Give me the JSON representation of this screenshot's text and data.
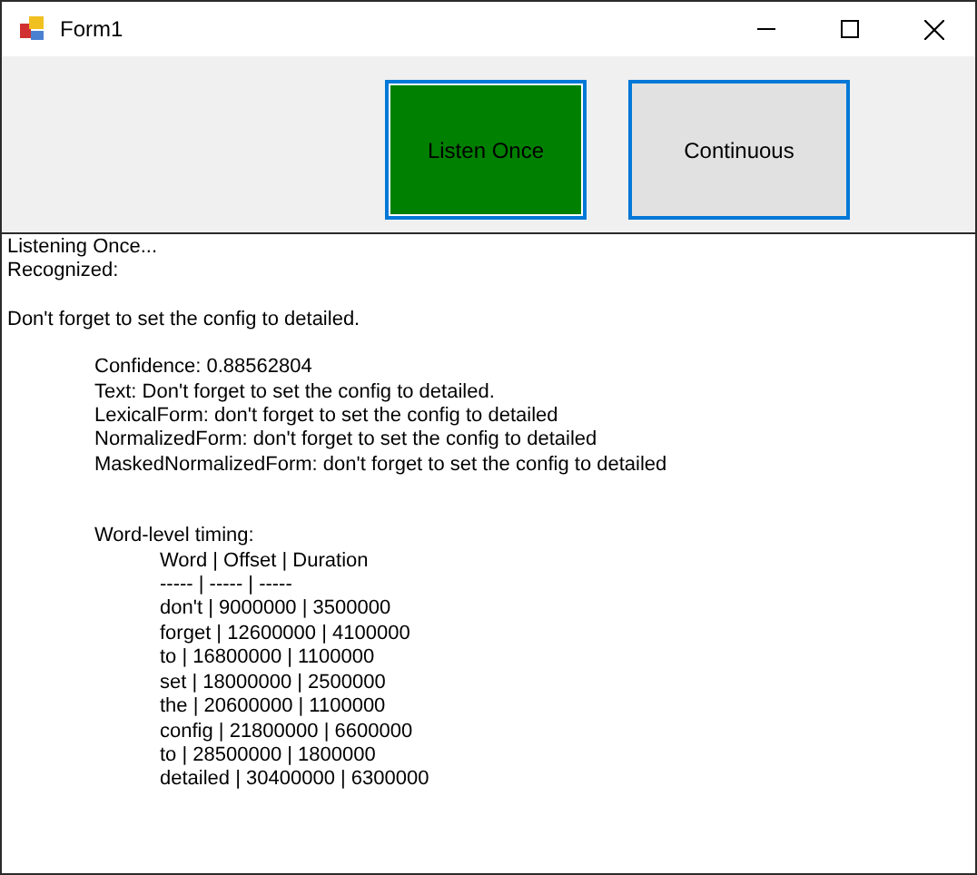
{
  "window": {
    "title": "Form1"
  },
  "buttons": [
    {
      "label": "Listen Once",
      "active": true
    },
    {
      "label": "Continuous",
      "active": false
    }
  ],
  "log": [
    {
      "text": "Listening Once..."
    },
    {
      "text": "Recognized:"
    },
    {
      "text": "Don't forget to set the config to detailed.",
      "children": [
        {
          "text": "Confidence: 0.88562804"
        },
        {
          "text": "Text: Don't forget to set the config to detailed."
        },
        {
          "text": "LexicalForm: don't forget to set the config to detailed"
        },
        {
          "text": "NormalizedForm: don't forget to set the config to detailed"
        },
        {
          "text": "MaskedNormalizedForm: don't forget to set the config to detailed"
        },
        {
          "text": "Word-level timing:",
          "children": [
            {
              "text": "Word | Offset | Duration"
            },
            {
              "text": "----- | ----- | -----"
            },
            {
              "text": "don't | 9000000 | 3500000"
            },
            {
              "text": "forget | 12600000 | 4100000"
            },
            {
              "text": "to | 16800000 | 1100000"
            },
            {
              "text": "set | 18000000 | 2500000"
            },
            {
              "text": "the | 20600000 | 1100000"
            },
            {
              "text": "config | 21800000 | 6600000"
            },
            {
              "text": "to | 28500000 | 1800000"
            },
            {
              "text": "detailed | 30400000 | 6300000"
            }
          ]
        }
      ]
    }
  ]
}
